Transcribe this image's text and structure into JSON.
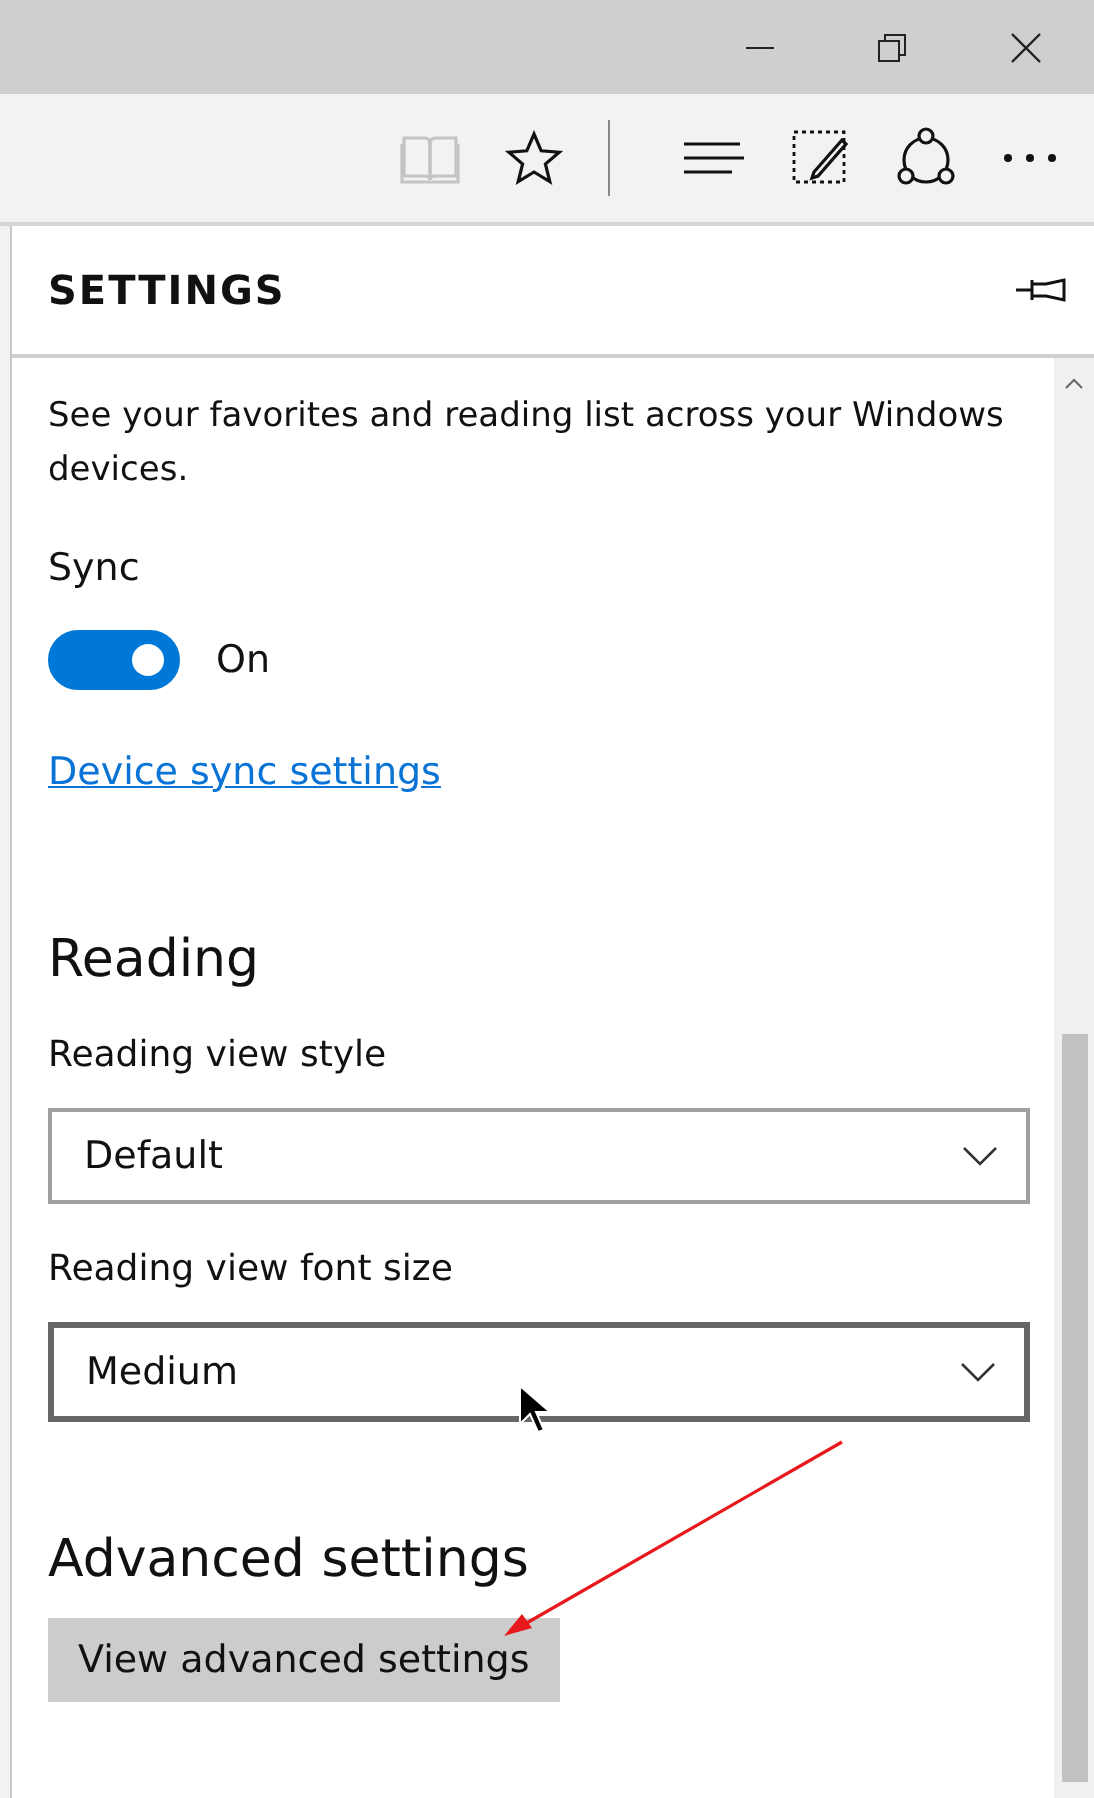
{
  "toolbar": {
    "reading_view_disabled": true
  },
  "panel": {
    "title": "SETTINGS"
  },
  "sync": {
    "description": "See your favorites and reading list across your Windows devices.",
    "label": "Sync",
    "on": true,
    "state_text": "On",
    "link": "Device sync settings"
  },
  "reading": {
    "heading": "Reading",
    "dropdowns": [
      {
        "label": "Reading view style",
        "value": "Default",
        "focused": false
      },
      {
        "label": "Reading view font size",
        "value": "Medium",
        "focused": true
      }
    ]
  },
  "advanced": {
    "heading": "Advanced settings",
    "button": "View advanced settings"
  }
}
